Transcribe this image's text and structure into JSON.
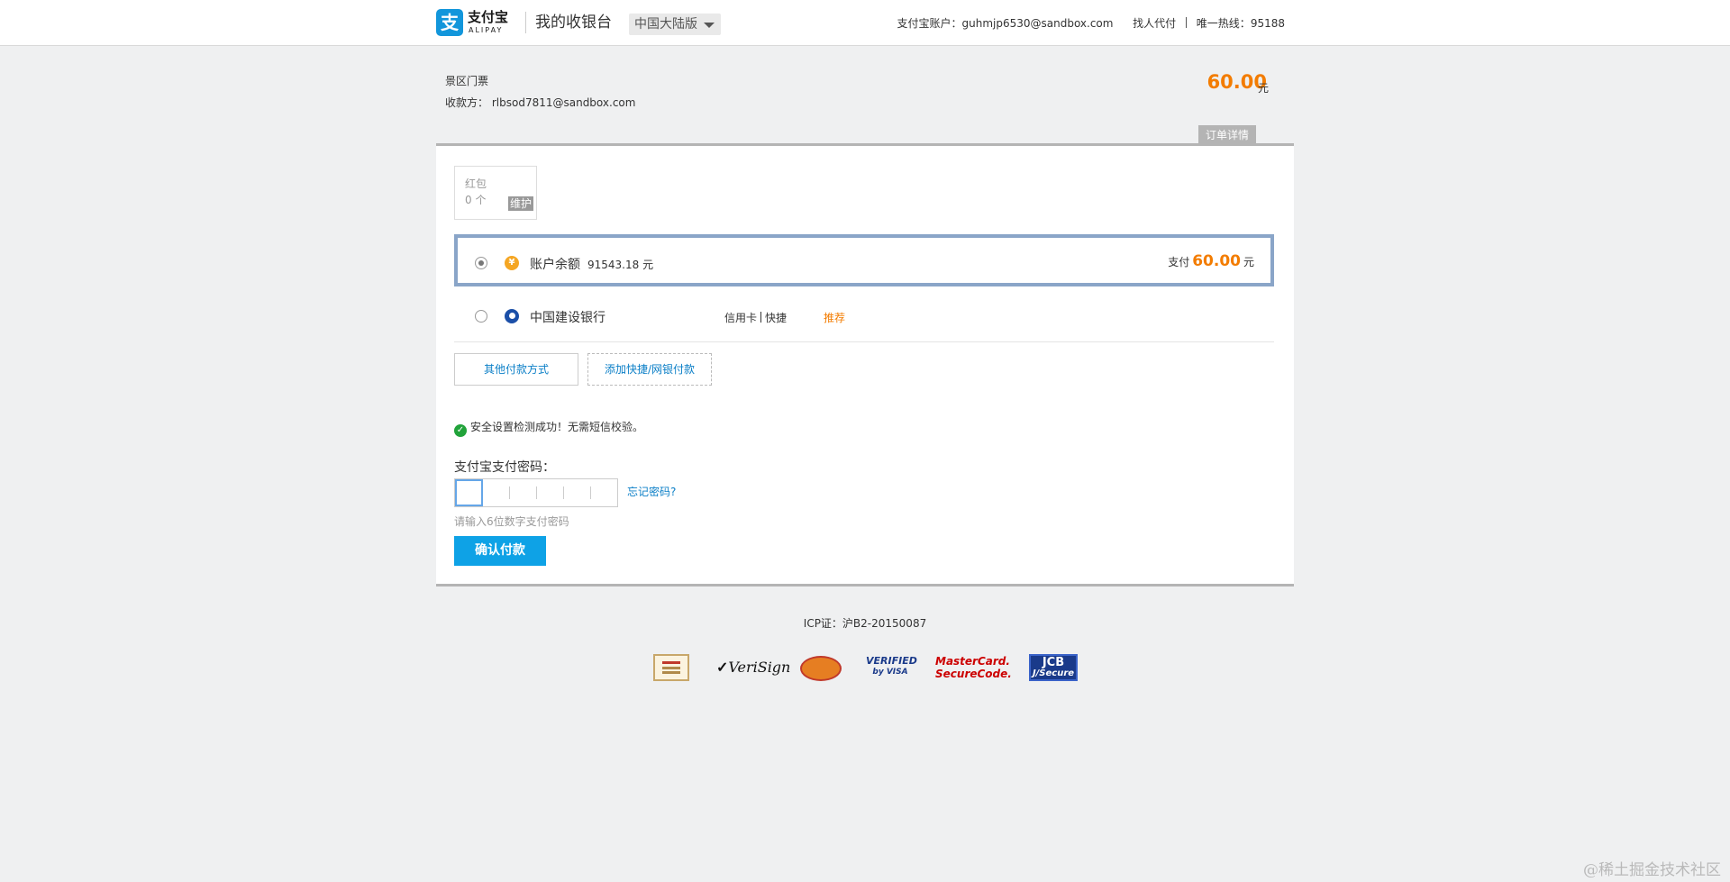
{
  "header": {
    "logo_cn": "支付宝",
    "logo_en": "ALIPAY",
    "title": "我的收银台",
    "region": "中国大陆版",
    "account_label": "支付宝账户：",
    "account_value": "guhmjp6530@sandbox.com",
    "find_proxy": "找人代付",
    "hotline_label": "唯一热线：",
    "hotline_value": "95188"
  },
  "order": {
    "name": "景区门票",
    "payee_label": "收款方：",
    "payee_value": "rlbsod7811@sandbox.com",
    "amount": "60.00",
    "unit": "元",
    "detail_button": "订单详情"
  },
  "red_packet": {
    "title": "红包",
    "count": "0 个",
    "badge": "维护"
  },
  "balance": {
    "label": "账户余额",
    "value": "91543.18 元",
    "pay_label": "支付",
    "pay_amount": "60.00",
    "pay_unit": "元",
    "icon": "yuan-coin-icon"
  },
  "bank": {
    "name": "中国建设银行",
    "tag1": "信用卡",
    "tag2": "快捷",
    "recommend": "推荐",
    "icon": "ccb-bank-icon"
  },
  "buttons": {
    "other_methods": "其他付款方式",
    "add_method": "添加快捷/网银付款",
    "confirm": "确认付款"
  },
  "security": {
    "message": "安全设置检测成功！无需短信校验。",
    "icon": "check-circle-icon"
  },
  "password": {
    "label": "支付宝支付密码：",
    "forgot": "忘记密码?",
    "hint": "请输入6位数字支付密码"
  },
  "footer": {
    "icp": "ICP证：沪B2-20150087",
    "cert_verisign": "VeriSign",
    "cert_visa_1": "VERIFIED",
    "cert_visa_2": "by VISA",
    "cert_mc_1": "MasterCard.",
    "cert_mc_2": "SecureCode.",
    "cert_jcb_1": "JCB",
    "cert_jcb_2": "J/Secure"
  },
  "watermark": "@稀土掘金技术社区",
  "colors": {
    "accent": "#0ea2e6",
    "amount": "#f37c00",
    "link": "#0b7fc7",
    "selected_border": "#8aa5c8"
  }
}
